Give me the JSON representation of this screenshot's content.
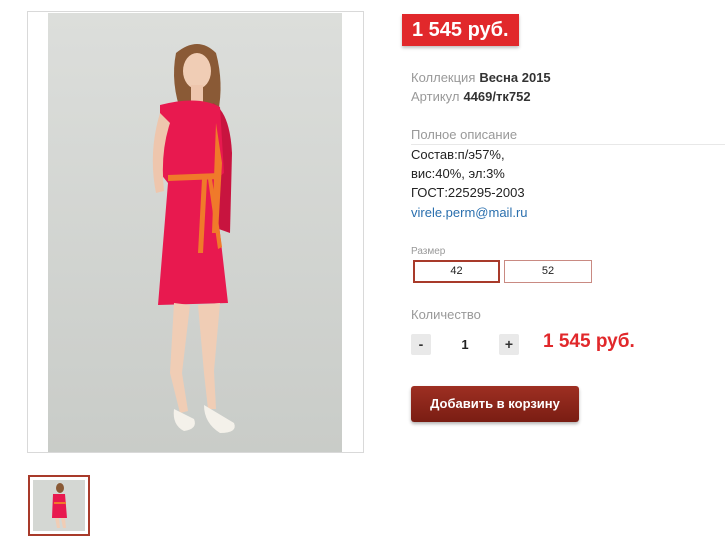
{
  "product": {
    "price_badge": "1 545 руб.",
    "collection": {
      "label": "Коллекция",
      "value": "Весна 2015"
    },
    "article": {
      "label": "Артикул",
      "value": "4469/тк752"
    }
  },
  "description": {
    "title": "Полное описание",
    "lines": [
      "Состав:п/э57%,",
      "вис:40%, эл:3%",
      "ГОСТ:225295-2003"
    ],
    "email": "virele.perm@mail.ru"
  },
  "size": {
    "label": "Размер",
    "options": [
      "42",
      "52"
    ],
    "selected": "42"
  },
  "quantity": {
    "label": "Количество",
    "minus": "-",
    "value": "1",
    "plus": "+"
  },
  "total_price": "1 545 руб.",
  "add_to_cart": "Добавить в корзину",
  "colors": {
    "accent_red": "#e1282b",
    "button_dark_red": "#8b2619",
    "dress": "#e8194f",
    "belt": "#f07a2a"
  }
}
